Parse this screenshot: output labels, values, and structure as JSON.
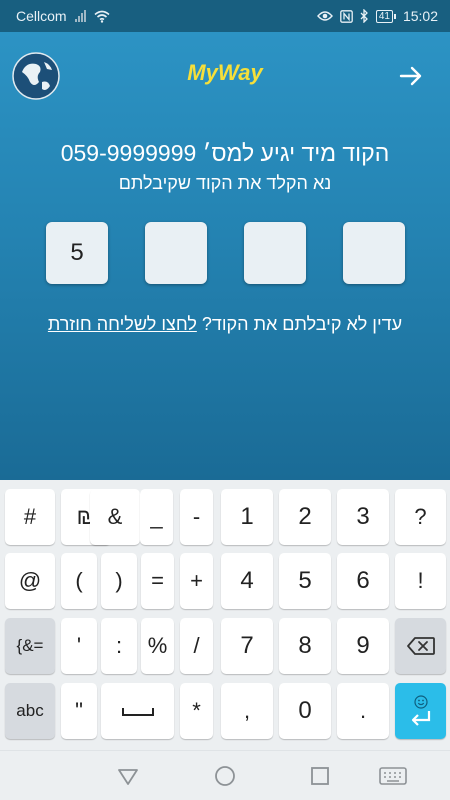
{
  "status": {
    "carrier": "Cellcom",
    "battery": "41",
    "time": "15:02"
  },
  "header": {
    "brand": "MyWay"
  },
  "verify": {
    "title": "הקוד מיד יגיע למס׳ 059-9999999",
    "subtitle": "נא הקלד את הקוד שקיבלתם",
    "code_digits": [
      "5",
      "",
      "",
      ""
    ],
    "resend_prefix": "עדין לא קיבלתם את הקוד?",
    "resend_link": "לחצו לשליחה חוזרת"
  },
  "keyboard": {
    "row1": [
      "#",
      "₪",
      "&",
      "_",
      "-",
      "1",
      "2",
      "3",
      "?"
    ],
    "row2": [
      "@",
      "(",
      ")",
      "=",
      "+",
      "4",
      "5",
      "6",
      "!"
    ],
    "row3": [
      "{&=",
      "'",
      ":",
      "%",
      "/",
      "7",
      "8",
      "9"
    ],
    "row4": [
      "abc",
      "\"",
      "*",
      ",",
      "0",
      "."
    ]
  },
  "colors": {
    "brand": "#f5df3a",
    "accent": "#2bbde9",
    "status_bar": "#185f80"
  }
}
